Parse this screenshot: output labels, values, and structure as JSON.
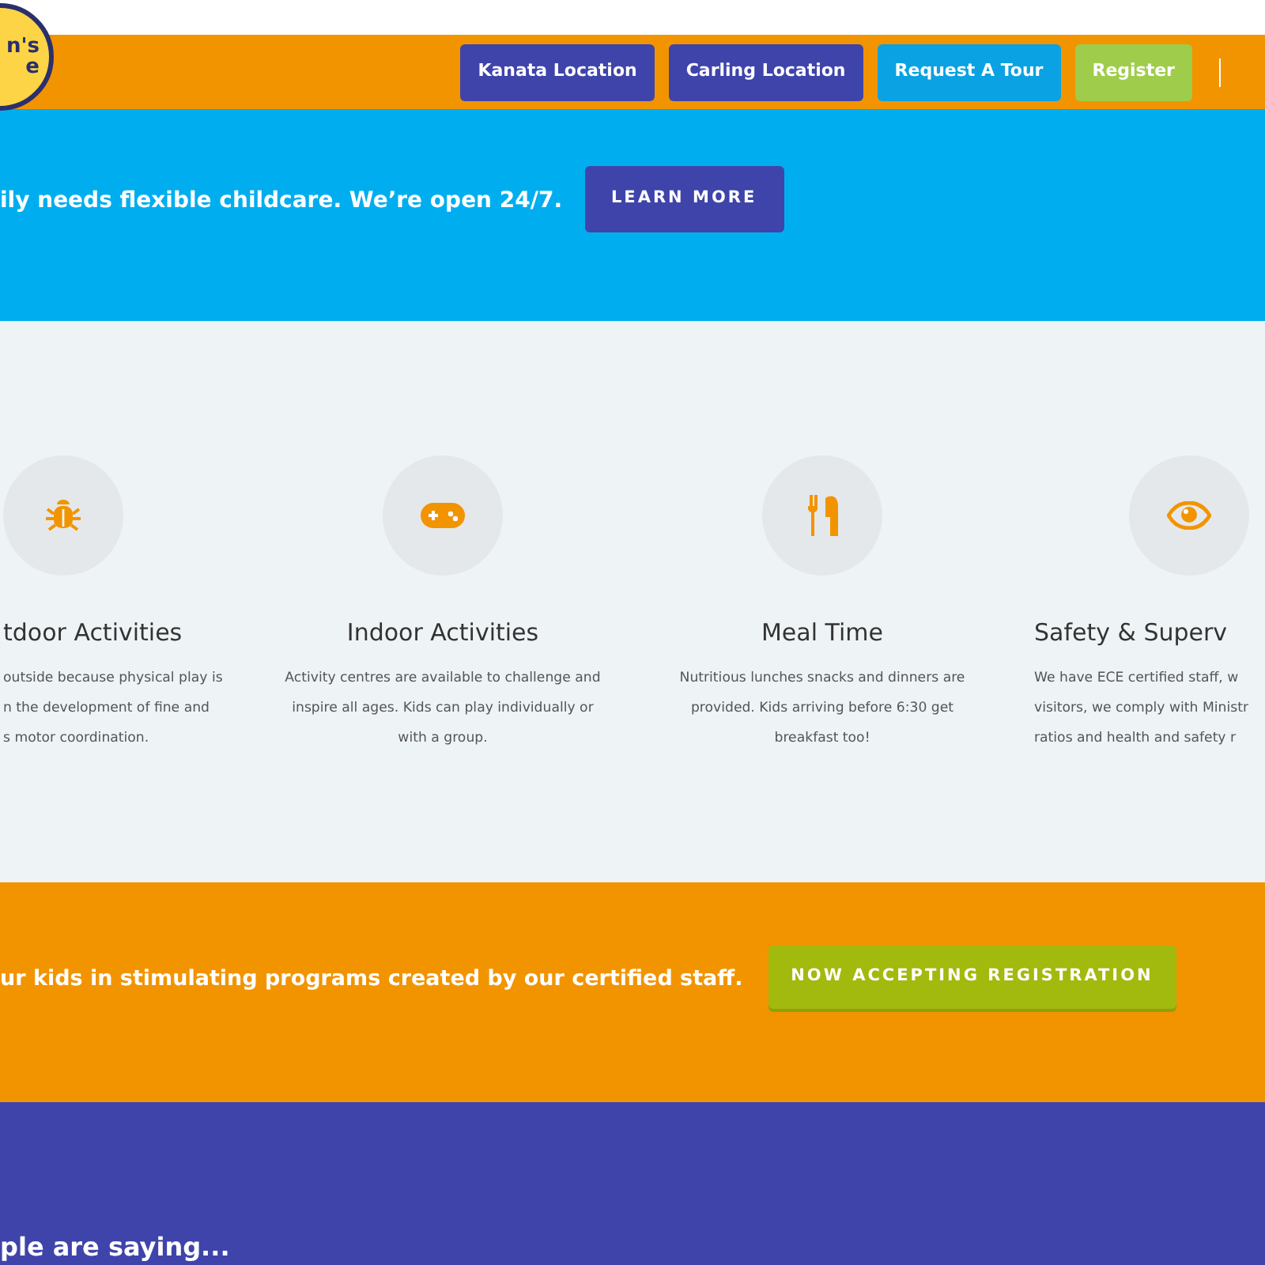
{
  "logo": {
    "lines": [
      "n's",
      "e"
    ]
  },
  "nav": {
    "buttons": [
      {
        "label": "Kanata Location",
        "kind": "primary"
      },
      {
        "label": "Carling Location",
        "kind": "primary"
      },
      {
        "label": "Request A Tour",
        "kind": "info"
      },
      {
        "label": "Register",
        "kind": "success"
      }
    ]
  },
  "banner": {
    "text": "ily needs flexible childcare. We’re open 24/7.",
    "button": "LEARN MORE"
  },
  "features": [
    {
      "title": "tdoor Activities",
      "lines": [
        "outside because physical play is",
        "n the development of fine and",
        "s motor coordination."
      ]
    },
    {
      "title": "Indoor Activities",
      "lines": [
        "Activity centres are available to challenge and",
        "inspire all ages. Kids can play individually or",
        "with a group."
      ]
    },
    {
      "title": "Meal Time",
      "lines": [
        "Nutritious lunches snacks and dinners are",
        "provided. Kids arriving before 6:30 get",
        "breakfast too!"
      ]
    },
    {
      "title": "Safety & Superv",
      "lines": [
        "We have ECE certified staff, w",
        "visitors, we comply with Ministr",
        "ratios and health and safety r"
      ]
    }
  ],
  "cta": {
    "text": "ur kids in stimulating programs created by our certified staff.",
    "button": "NOW ACCEPTING REGISTRATION"
  },
  "testimonials": {
    "heading": "ple are saying..."
  }
}
